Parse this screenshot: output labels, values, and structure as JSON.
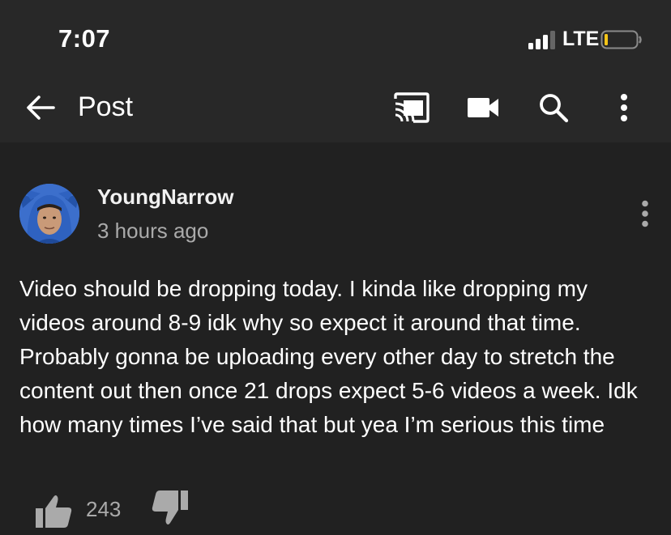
{
  "status_bar": {
    "time": "7:07",
    "network": "LTE",
    "icons": [
      "signal-icon",
      "battery-icon"
    ]
  },
  "header": {
    "title": "Post",
    "icons": [
      "back-arrow-icon",
      "cast-icon",
      "video-camera-icon",
      "search-icon",
      "more-vert-icon"
    ]
  },
  "post": {
    "author": "YoungNarrow",
    "time_ago": "3 hours ago",
    "text": "Video should be dropping today. I kinda like dropping my videos around 8-9 idk why so expect it around that time. Probably gonna be uploading every other day to stretch the content out then once 21 drops expect 5-6 videos a week. Idk how many times I’ve said that but yea I’m serious this time",
    "like_count": "243"
  },
  "colors": {
    "background": "#212121",
    "bar": "#282828",
    "secondary_text": "#aaaaaa",
    "battery_level": "#f5c518"
  }
}
